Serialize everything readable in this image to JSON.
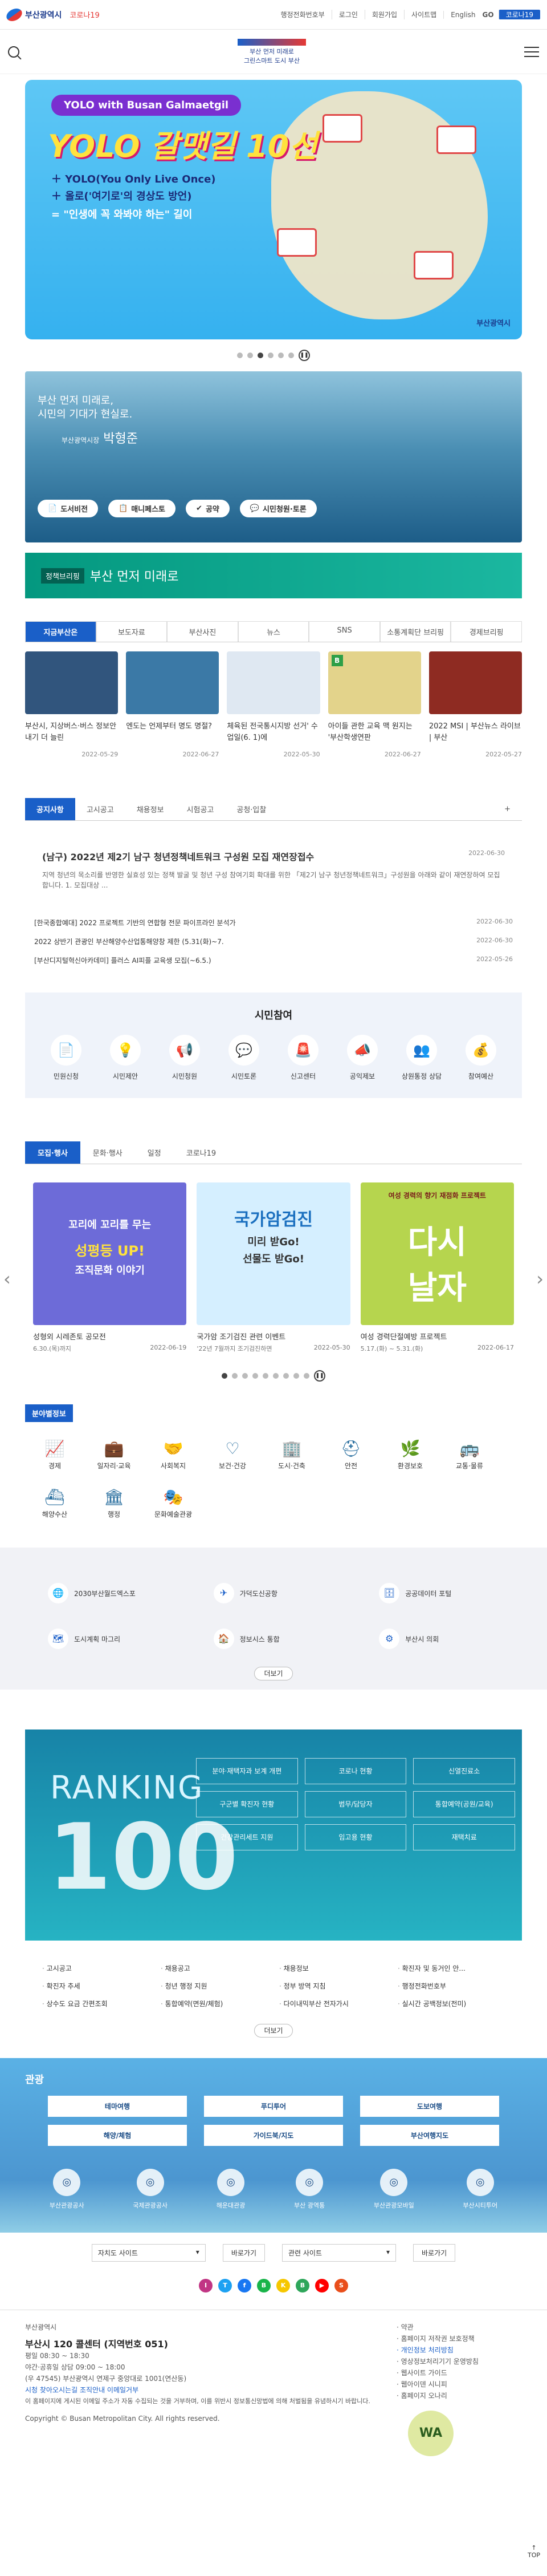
{
  "header": {
    "logo_text": "부산광역시",
    "corona": "코로나19",
    "util": [
      "행정전화번호부",
      "로그인",
      "회원가입",
      "사이트맵"
    ],
    "lang": "English",
    "go": "GO",
    "corona_btn": "코로나19",
    "slogan": "부산 먼저 미래로",
    "slogan_sub": "그린스마트 도시 부산"
  },
  "hero": {
    "badge": "YOLO with Busan Galmaetgil",
    "title": "YOLO 갈맷길 10선",
    "line1": "＋ YOLO(You Only Live Once)",
    "line2": "＋ 올로('여기로'의 경상도 방언)",
    "line3": "= \"인생에 꼭 와봐야 하는\" 길이",
    "seal": "부산광역시"
  },
  "mayor": {
    "t1": "부산 먼저 미래로,",
    "t2": "시민의 기대가 현실로.",
    "t3": "부산광역시장",
    "name": "박형준",
    "buttons": [
      "도서비전",
      "매니페스토",
      "공약",
      "시민청원·토론"
    ]
  },
  "policy": {
    "tag": "정책브리핑",
    "text": "부산 먼저 미래로"
  },
  "tabs": [
    "지금부산은",
    "보도자료",
    "부산사진",
    "뉴스",
    "SNS",
    "소통계획단 브리핑",
    "경제브리핑"
  ],
  "news": [
    {
      "cap": "부산시, 지상버스·버스 정보안내기 더 늘린",
      "date": "2022-05-29",
      "color": "#31557d"
    },
    {
      "cap": "엔도는 언제부터 명도 명절?",
      "date": "2022-06-27",
      "color": "#3b79a6"
    },
    {
      "cap": "체육된 전국통시지방 선거' 수업일(6. 1)에",
      "date": "2022-05-30",
      "color": "#dfe8f2"
    },
    {
      "cap": "아이들 관한 교육 맥 원지는 '부산학생연판",
      "date": "2022-06-27",
      "color": "#e3d38b"
    },
    {
      "cap": "2022 MSI | 부산뉴스 라이브 | 부산",
      "date": "2022-05-27",
      "color": "#8e2b22"
    }
  ],
  "notice": {
    "tabs": [
      "공지사항",
      "고시공고",
      "채용정보",
      "시험공고",
      "공청·입찰"
    ],
    "main_title": "(남구) 2022년 제2기 남구 청년정책네트워크 구성원 모집 재연장접수",
    "main_date": "2022-06-30",
    "main_text": "지역 청년의 목소리를 반영한 실효성 있는 정책 발굴 및 청년 구성 참여기회 확대를 위한 「제2기 남구 청년정책네트워크」구성원을 아래와 같이 재연장하여 모집합니다. 1. 모집대상 ...",
    "list": [
      {
        "t": "[한국종합예대] 2022 프로젝트 기반의 연합형 전문 파이프라인 분석가",
        "d": "2022-06-30"
      },
      {
        "t": "2022 상반기 관광인 부산해양수산업통해양창 제한 (5.31(화)~7.",
        "d": "2022-06-30"
      },
      {
        "t": "[부산디지털혁신아카데미] 플러스 AI피플 교육생 모집(~6.5.)",
        "d": "2022-05-26"
      }
    ]
  },
  "civic": {
    "title": "시민참여",
    "items": [
      "민원신청",
      "시민제안",
      "시민청원",
      "시민토론",
      "신고센터",
      "공익제보",
      "상원통정 상담",
      "참여예산"
    ]
  },
  "promo": {
    "tabs": [
      "모집·행사",
      "문화·행사",
      "일정",
      "코로나19"
    ],
    "cards": [
      {
        "cap": "성형외 시레존토 공모전",
        "sub": "6.30.(목)까지",
        "date": "2022-06-19",
        "big": "꼬리에 꼬리를 무는",
        "big2": "성평등 UP!",
        "big3": "조직문화 이야기",
        "color": "#6d6bd8"
      },
      {
        "cap": "국가암 조기검진 관련 이벤트",
        "sub": "'22년 7월까지 조기검진하면",
        "date": "2022-05-30",
        "big": "국가암검진",
        "big2": "미리 받Go!",
        "big3": "선물도 받Go!",
        "color": "#40a8e8"
      },
      {
        "cap": "여성 경력단절예방 프로젝트",
        "sub": "5.17.(화) ~ 5.31.(화)",
        "date": "2022-06-17",
        "big": "다시",
        "big2": "날자",
        "big3": "여성 경력의 향기 재점화 프로젝트",
        "color": "#b6d54e"
      }
    ]
  },
  "field": {
    "title": "분야별정보",
    "items": [
      "경제",
      "일자리·교육",
      "사회복지",
      "보건·건강",
      "도시·건축",
      "안전",
      "환경보호",
      "교통·물류",
      "해양수산",
      "행정",
      "문화예술관광"
    ]
  },
  "links": {
    "items": [
      "2030부산월드엑스포",
      "가덕도신공항",
      "공공데이터 포털",
      "도시계획 마그리",
      "정보시스 통합",
      "부산시 의회"
    ],
    "more": "더보기"
  },
  "ranking": {
    "r1": "RANKING",
    "r2": "100",
    "grid": [
      "분야·재택자과 보계 개편",
      "코로나 현황",
      "신열진료소",
      "구군별 확진자 현황",
      "범무/담당자",
      "통합예약(공원/교육)",
      "건강관리세트 지원",
      "임고용 현황",
      "재택치료"
    ]
  },
  "sites": [
    "고시공고",
    "채용공고",
    "채용정보",
    "확진자 및 동거인 안...",
    "확진자 추세",
    "청년 행정 지원",
    "정부 방역 지침",
    "행정전화번호부",
    "상수도 요금 간편조회",
    "통합예약(면원/체험)",
    "다이내믹부산 전자가시",
    "실시간 공백정보(전미)"
  ],
  "sites_more": "더보기",
  "tour": {
    "title": "관광",
    "grid": [
      "테마여행",
      "푸디투어",
      "도보여행",
      "해양/체험",
      "가이드북/지도",
      "부산여행지도"
    ],
    "icons": [
      "부산관광공사",
      "국제관광공사",
      "해운대관광",
      "부산 광역통",
      "부산관광모바일",
      "부산시티투어"
    ]
  },
  "selects": [
    "자치도 사이트",
    "관련 사이트"
  ],
  "go_label": "바로가기",
  "footer": {
    "org": "부산광역시",
    "addr": "부산시 120 콜센터 (지역번호 051)",
    "hours": "평일 08:30 ~ 18:30",
    "hours2": "야간·공휴일 상담 09:00 ~ 18:00",
    "addr2": "(우 47545) 부산광역시 연제구 중앙대로 1001(연산동)",
    "links": "시청 찾아오시는길  조직안내  이메일거부",
    "notice": "이 홈페이지에 게시된 이메일 주소가 자동 수집되는 것을 거부하며, 이를 위반시 정보통신망법에 의해 처벌됨을 유념하시기 바랍니다.",
    "copy": "Copyright © Busan Metropolitan City. All rights reserved.",
    "right": [
      "약관",
      "홈페이지 저작권 보호정책",
      "개인정보 처리방침",
      "영상정보처리기기 운영방침",
      "웹사이트 가이드",
      "웹아이덴 시니피",
      "홈페이지 오나리"
    ],
    "wa": "WA"
  },
  "top": "TOP"
}
